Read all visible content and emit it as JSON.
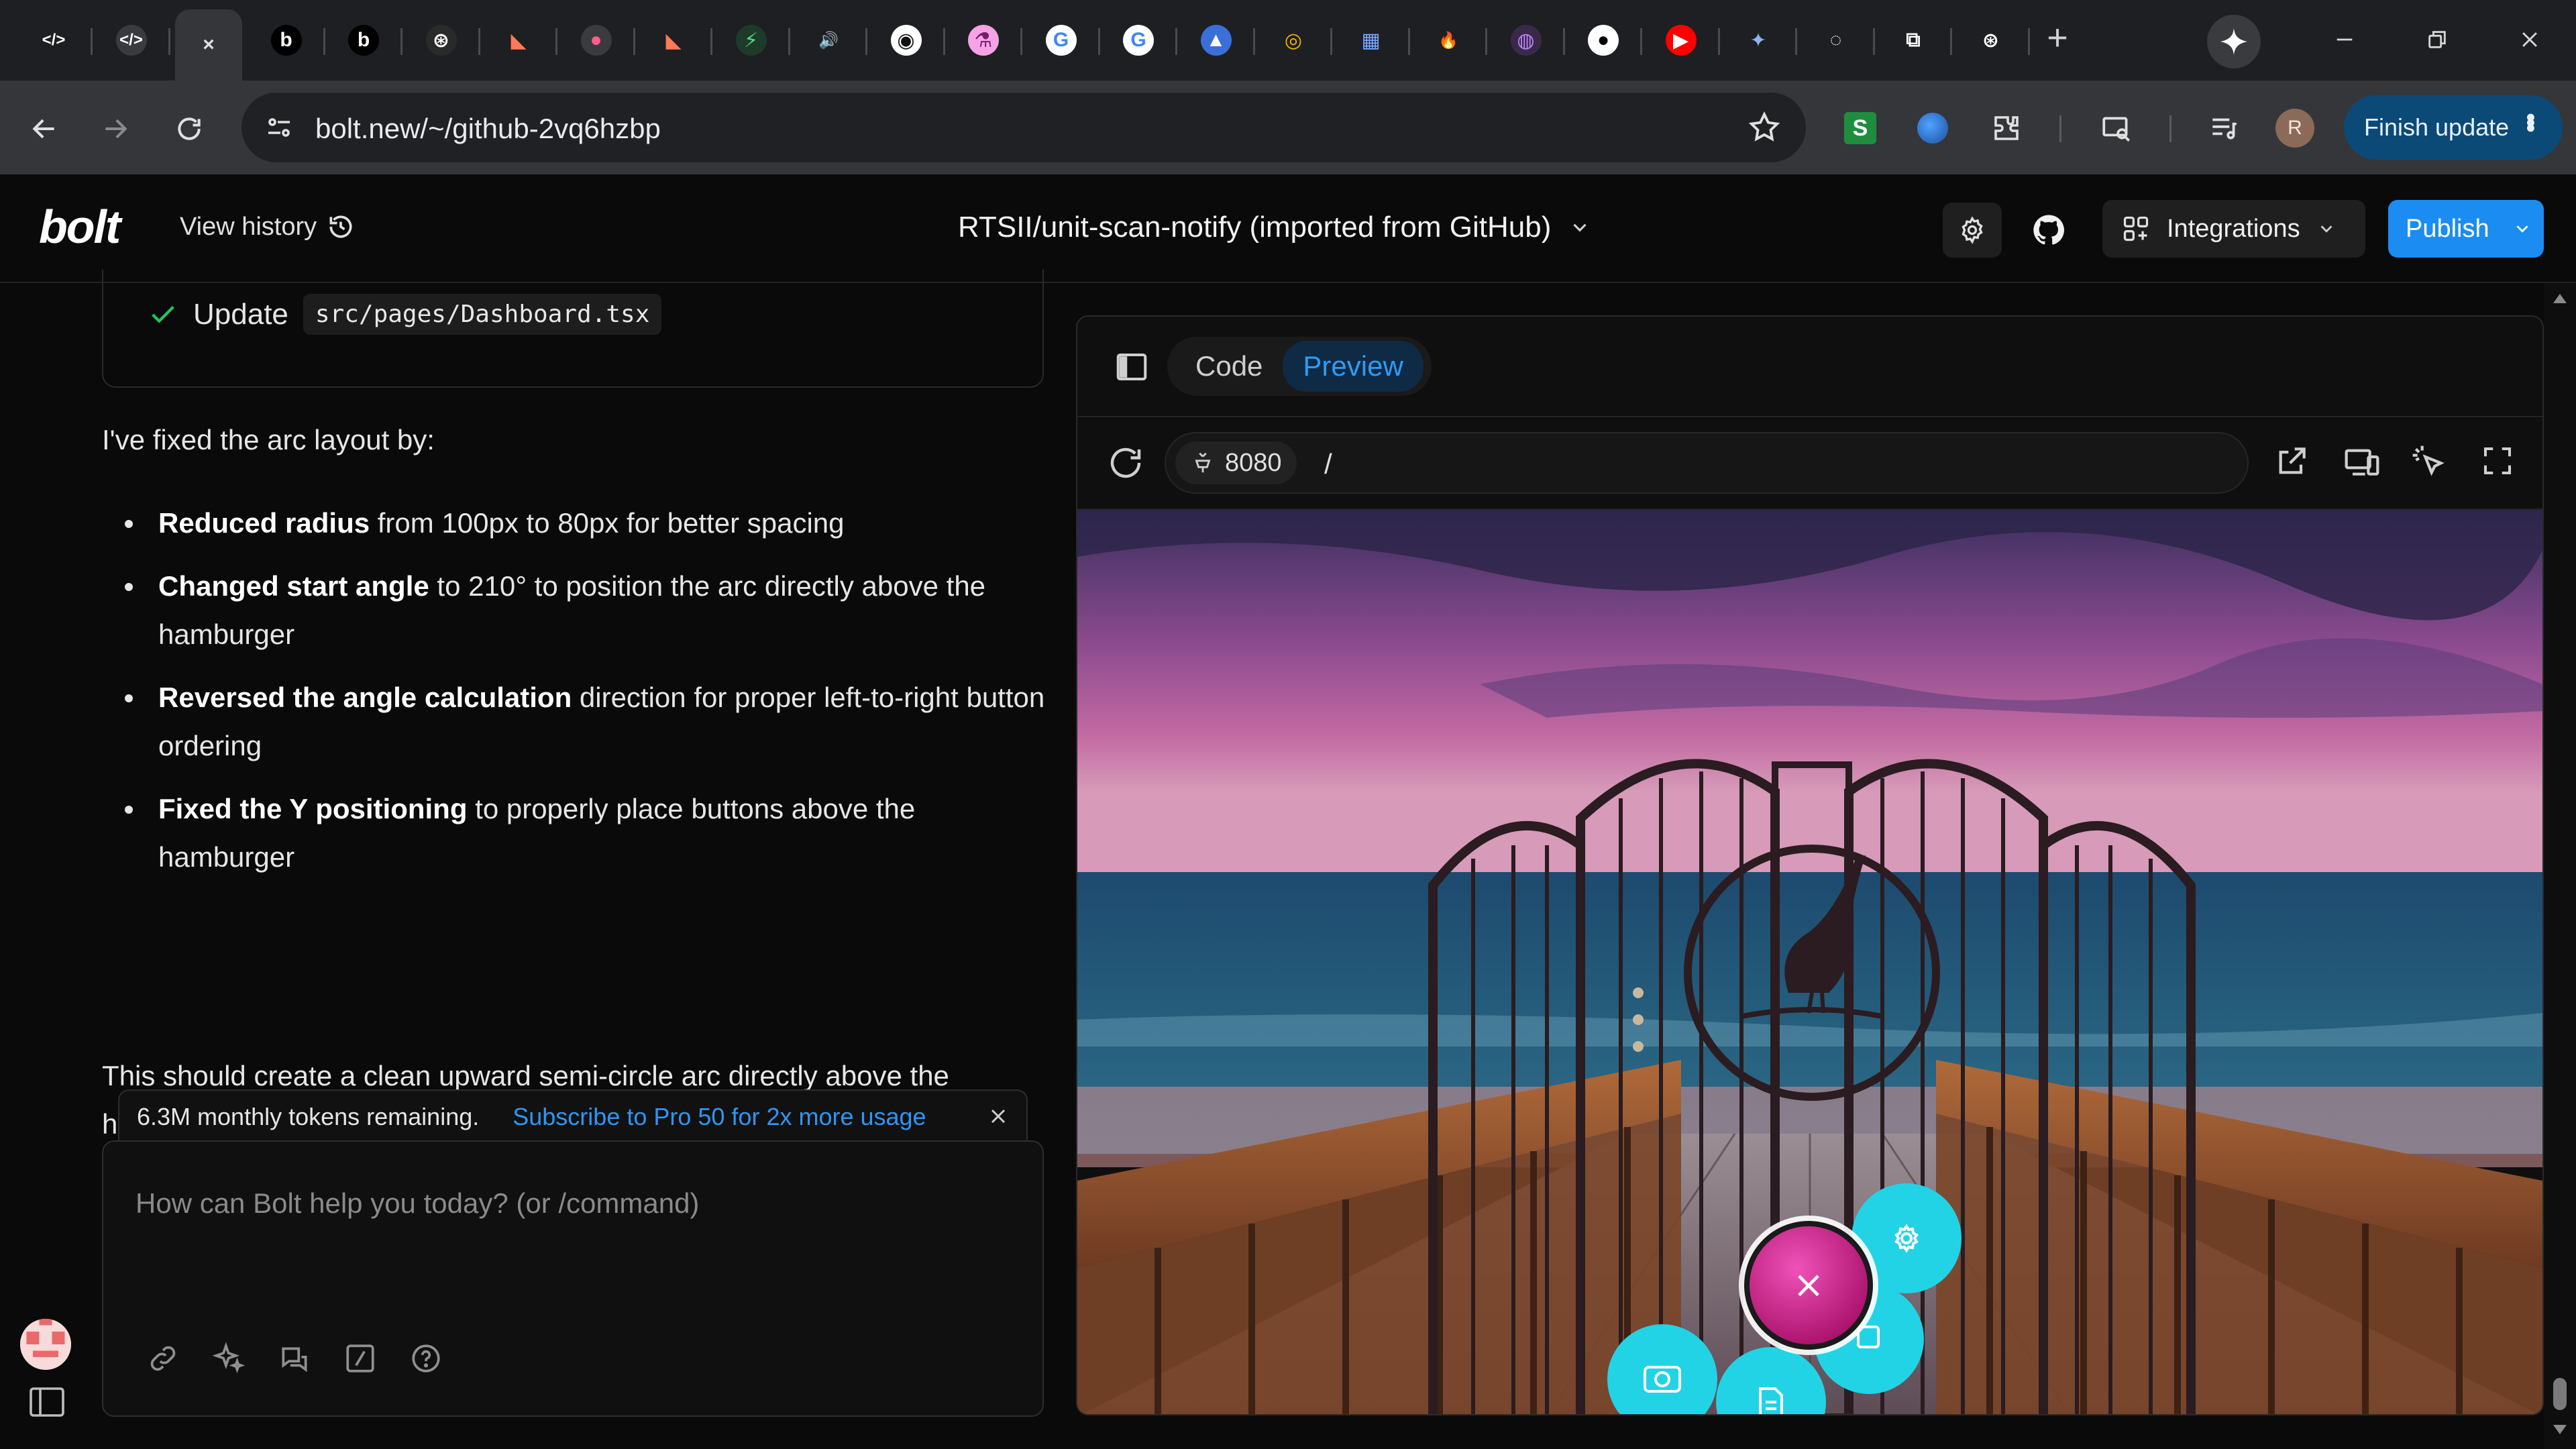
{
  "browser": {
    "tabs": [
      {
        "name": "tab-dev",
        "glyph": "</>",
        "bg": "#1e1f22",
        "fg": "#ffffff"
      },
      {
        "name": "tab-dev-2",
        "glyph": "</>",
        "bg": "#3a3b3f",
        "fg": "#ffffff"
      },
      {
        "name": "tab-active",
        "glyph": "×",
        "bg": "#35363a",
        "fg": "#e0e0e0"
      },
      {
        "name": "tab-bolt-1",
        "glyph": "b",
        "bg": "#000000",
        "fg": "#ffffff"
      },
      {
        "name": "tab-bolt-2",
        "glyph": "b",
        "bg": "#000000",
        "fg": "#ffffff"
      },
      {
        "name": "tab-openai",
        "glyph": "⊛",
        "bg": "#2a2a2a",
        "fg": "#ffffff"
      },
      {
        "name": "tab-app-1",
        "glyph": "◣",
        "bg": "#1e1f22",
        "fg": "#ff7a59"
      },
      {
        "name": "tab-app-2",
        "glyph": "●",
        "bg": "#3a3b3f",
        "fg": "#ff5e8a"
      },
      {
        "name": "tab-app-3",
        "glyph": "◣",
        "bg": "#1e1f22",
        "fg": "#ff7a59"
      },
      {
        "name": "tab-app-4",
        "glyph": "⚡",
        "bg": "#1e3a2a",
        "fg": "#4ade80"
      },
      {
        "name": "tab-audio",
        "glyph": "🔊",
        "bg": "#1e1f22",
        "fg": "#dddddd"
      },
      {
        "name": "tab-app-5",
        "glyph": "◉",
        "bg": "#ffffff",
        "fg": "#111111"
      },
      {
        "name": "tab-lab",
        "glyph": "⚗",
        "bg": "#f5a3e5",
        "fg": "#7a1b6e"
      },
      {
        "name": "tab-google-1",
        "glyph": "G",
        "bg": "#ffffff",
        "fg": "#4285f4"
      },
      {
        "name": "tab-google-2",
        "glyph": "G",
        "bg": "#ffffff",
        "fg": "#4285f4"
      },
      {
        "name": "tab-drive",
        "glyph": "▲",
        "bg": "#3a6fd8",
        "fg": "#ffffff"
      },
      {
        "name": "tab-cloud",
        "glyph": "◎",
        "bg": "#1e1f22",
        "fg": "#f4b400"
      },
      {
        "name": "tab-app-6",
        "glyph": "▦",
        "bg": "#1e1f22",
        "fg": "#7aa7ff"
      },
      {
        "name": "tab-fire",
        "glyph": "🔥",
        "bg": "#1e1f22",
        "fg": "#ff6a00"
      },
      {
        "name": "tab-app-7",
        "glyph": "◍",
        "bg": "#3a2a4a",
        "fg": "#c084fc"
      },
      {
        "name": "tab-github",
        "glyph": "●",
        "bg": "#ffffff",
        "fg": "#000000"
      },
      {
        "name": "tab-youtube",
        "glyph": "▶",
        "bg": "#ff0000",
        "fg": "#ffffff"
      },
      {
        "name": "tab-gemini",
        "glyph": "✦",
        "bg": "#1e1f22",
        "fg": "#8ab4f8"
      },
      {
        "name": "tab-app-8",
        "glyph": "◌",
        "bg": "#1e1f22",
        "fg": "#ffffff"
      },
      {
        "name": "tab-app-9",
        "glyph": "⧉",
        "bg": "#1e1f22",
        "fg": "#ffffff"
      },
      {
        "name": "tab-openai-2",
        "glyph": "⊛",
        "bg": "#1e1f22",
        "fg": "#ffffff"
      }
    ],
    "new_tab": "+",
    "url": "bolt.new/~/github-2vq6hzbp",
    "profile_initial": "R",
    "finish_update": "Finish update"
  },
  "header": {
    "logo": "bolt",
    "view_history": "View history",
    "project_title": "RTSII/unit-scan-notify (imported from GitHub)",
    "integrations": "Integrations",
    "publish": "Publish"
  },
  "chat": {
    "update_label": "Update",
    "update_file": "src/pages/Dashboard.tsx",
    "intro": "I've fixed the arc layout by:",
    "bullets": [
      {
        "bold": "Reduced radius",
        "rest": " from 100px to 80px for better spacing"
      },
      {
        "bold": "Changed start angle",
        "rest": " to 210° to position the arc directly above the hamburger"
      },
      {
        "bold": "Reversed the angle calculation",
        "rest": " direction for proper left-to-right button ordering"
      },
      {
        "bold": "Fixed the Y positioning",
        "rest": " to properly place buttons above the hamburger"
      }
    ],
    "outro": "This should create a clean upward semi-circle arc directly above the hamburger button.",
    "tokens_remaining": "6.3M monthly tokens remaining.",
    "subscribe_link": "Subscribe to Pro 50 for 2x more usage",
    "prompt_placeholder": "How can Bolt help you today? (or /command)"
  },
  "preview": {
    "tab_code": "Code",
    "tab_preview": "Preview",
    "port": "8080",
    "path": "/",
    "fab_close": "×"
  },
  "colors": {
    "accent": "#1b8cf2",
    "link": "#2f96f3",
    "fab_magenta": "#d4268f",
    "fab_cyan": "#22d3e6"
  }
}
